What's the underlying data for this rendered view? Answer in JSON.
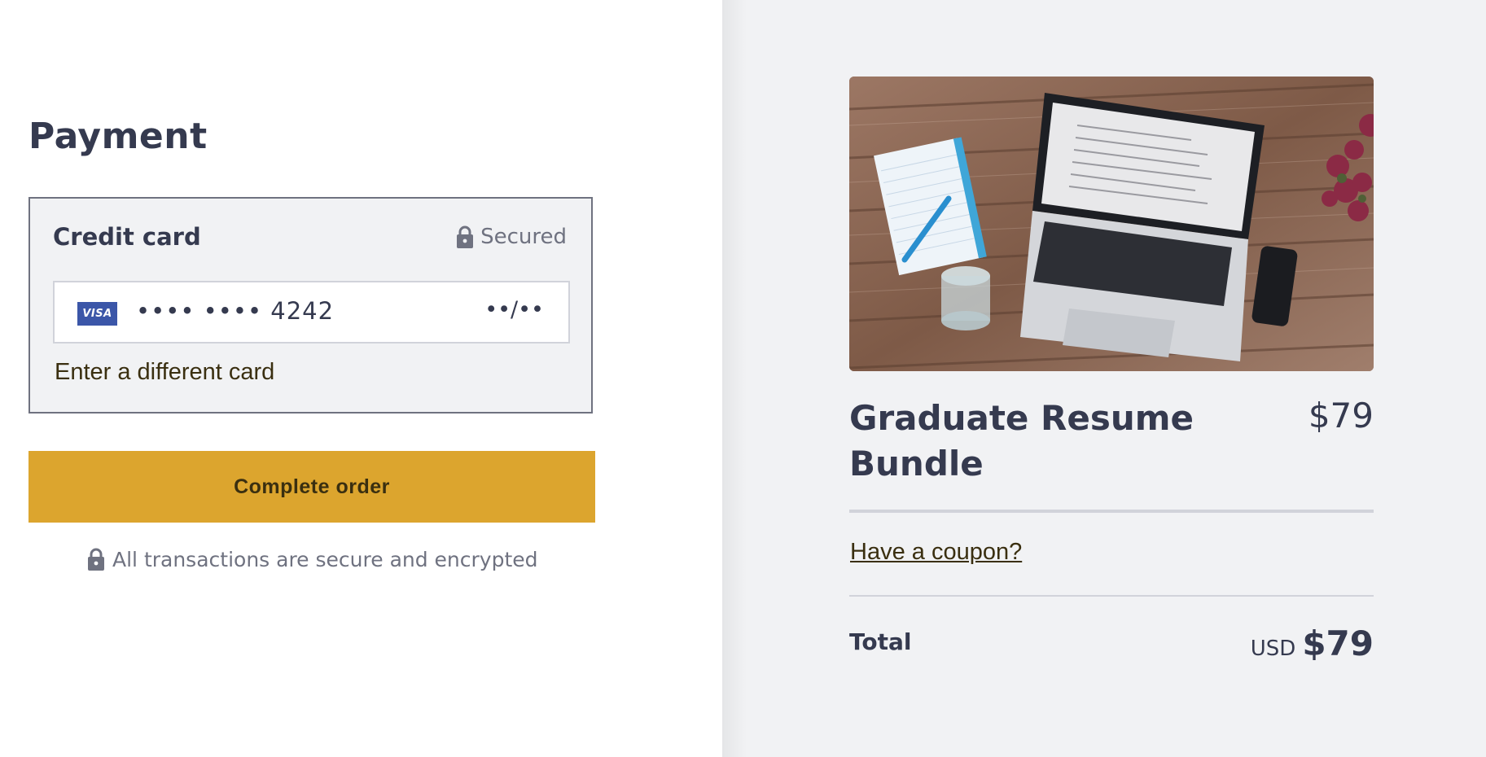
{
  "payment": {
    "heading": "Payment",
    "card_section": {
      "title": "Credit card",
      "secured_label": "Secured",
      "card_brand": "VISA",
      "card_number": "•••• •••• 4242",
      "card_expiry": "••/••",
      "different_card_link": "Enter a different card"
    },
    "complete_button": "Complete order",
    "secure_note": "All transactions are secure and encrypted"
  },
  "order": {
    "product_name": "Graduate Resume Bundle",
    "product_price": "$79",
    "coupon_link": "Have a coupon?",
    "total_label": "Total",
    "total_currency": "USD",
    "total_amount": "$79"
  },
  "colors": {
    "accent": "#dca52e",
    "text": "#353a4f",
    "muted": "#6f7280",
    "summary_bg": "#f1f2f4",
    "visa": "#3b56a8"
  },
  "icons": [
    "lock-icon",
    "visa-icon"
  ]
}
